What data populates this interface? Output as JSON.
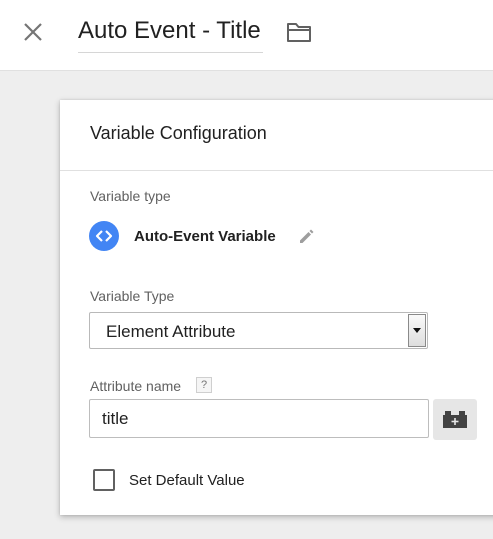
{
  "header": {
    "title": "Auto Event - Title",
    "close_icon": "close-icon",
    "folder_icon": "folder-icon"
  },
  "config": {
    "heading": "Variable Configuration",
    "variable_type_label": "Variable type",
    "variable_type_name": "Auto-Event Variable",
    "variable_type_icon": "code-brackets-icon",
    "variable_type_select_label": "Variable Type",
    "variable_type_select_value": "Element Attribute",
    "attribute_name_label": "Attribute name",
    "help_glyph": "?",
    "attribute_name_value": "title",
    "default_value_label": "Set Default Value",
    "default_value_checked": false
  },
  "colors": {
    "accent": "#4285f4",
    "background": "#eeeeee"
  }
}
